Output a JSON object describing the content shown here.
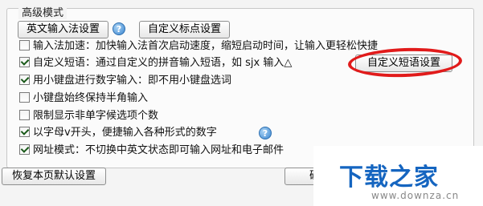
{
  "group": {
    "title": "高级模式"
  },
  "top_buttons": {
    "ime_settings": "英文输入法设置",
    "punct_settings": "自定义标点设置"
  },
  "options": [
    {
      "text": "输入法加速：加快输入法首次启动速度，缩短启动时间，让输入更轻松快捷",
      "checked": false
    },
    {
      "text": "自定义短语：通过自定义的拼音输入短语，如 sjx 输入△",
      "checked": true
    },
    {
      "text": "用小键盘进行数字输入：即不用小键盘选词",
      "checked": true
    },
    {
      "text": "小键盘始终保持半角输入",
      "checked": false
    },
    {
      "text": "限制显示非单字候选项个数",
      "checked": false
    },
    {
      "text": "以字母v开头，便捷输入各种形式的数字",
      "checked": true
    },
    {
      "text": "网址模式：不切换中英文状态即可输入网址和电子邮件",
      "checked": true
    }
  ],
  "phrase_settings_button": "自定义短语设置",
  "footer": {
    "restore_defaults": "恢复本页默认设置",
    "confirm": "确定"
  },
  "watermark": {
    "title": "下载之家",
    "url": "www.downza.cn"
  },
  "colors": {
    "highlight_ellipse": "#e11b1b",
    "watermark_title": "#1565c0"
  }
}
